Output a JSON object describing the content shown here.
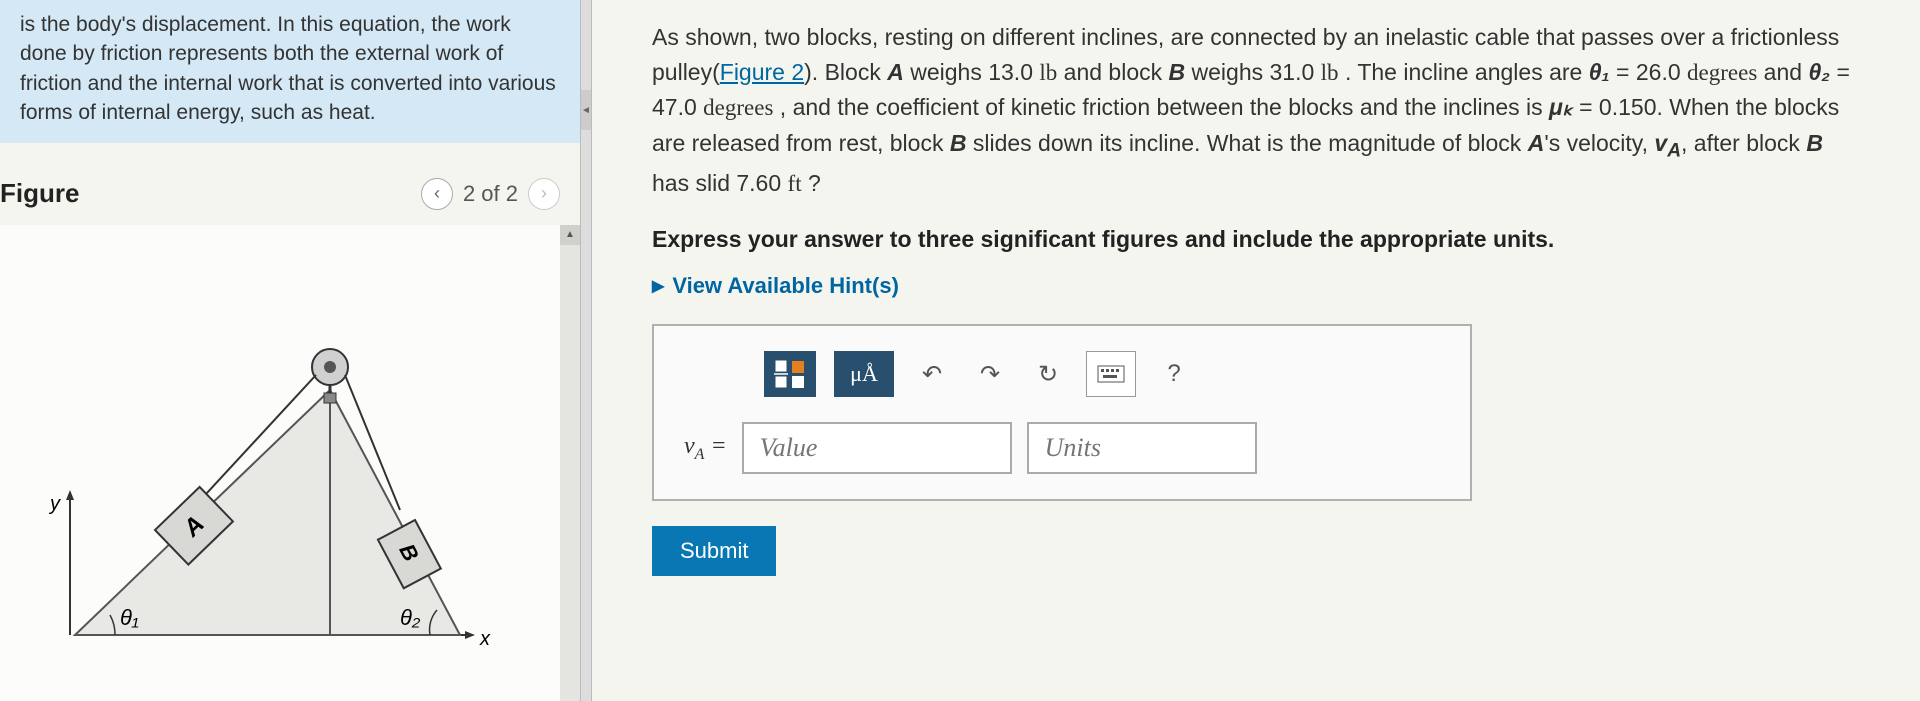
{
  "info_box": {
    "text_partial": "is the body's displacement. In this equation, the work done by friction represents both the external work of friction and the internal work that is converted into various forms of internal energy, such as heat."
  },
  "figure": {
    "title": "Figure",
    "nav_text": "2 of 2",
    "labels": {
      "block_a": "A",
      "block_b": "B",
      "theta1": "θ₁",
      "theta2": "θ₂",
      "axis_x": "x",
      "axis_y": "y"
    }
  },
  "problem": {
    "text_start": "As shown, two blocks, resting on different inclines, are connected by an inelastic cable that passes over a frictionless pulley(",
    "figure_link": "Figure 2",
    "text_mid1": "). Block ",
    "var_A": "A",
    "text_mid2": " weighs 13.0 ",
    "unit_lb1": "lb",
    "text_mid3": " and block ",
    "var_B": "B",
    "text_mid4": " weighs 31.0 ",
    "unit_lb2": "lb",
    "text_mid5": " . The incline angles are ",
    "var_theta1": "θ₁",
    "text_eq1": " = 26.0 ",
    "unit_deg1": "degrees",
    "text_and": " and ",
    "var_theta2": "θ₂",
    "text_eq2": " = 47.0 ",
    "unit_deg2": "degrees",
    "text_mid6": " , and the coefficient of kinetic friction between the blocks and the inclines is ",
    "var_muk": "μₖ",
    "text_eq3": " = 0.150. When the blocks are released from rest, block ",
    "var_B2": "B",
    "text_mid7": " slides down its incline. What is the magnitude of block ",
    "var_A2": "A",
    "text_mid8": "'s velocity, ",
    "var_vA": "v",
    "var_vA_sub": "A",
    "text_mid9": ", after block ",
    "var_B3": "B",
    "text_end": " has slid 7.60 ",
    "unit_ft": "ft",
    "text_q": " ?"
  },
  "instruction": "Express your answer to three significant figures and include the appropriate units.",
  "hints": {
    "label": "View Available Hint(s)"
  },
  "toolbar": {
    "units_label": "μÅ",
    "help_label": "?"
  },
  "answer": {
    "var": "v",
    "var_sub": "A",
    "equals": " = ",
    "value_placeholder": "Value",
    "units_placeholder": "Units"
  },
  "submit": {
    "label": "Submit"
  }
}
